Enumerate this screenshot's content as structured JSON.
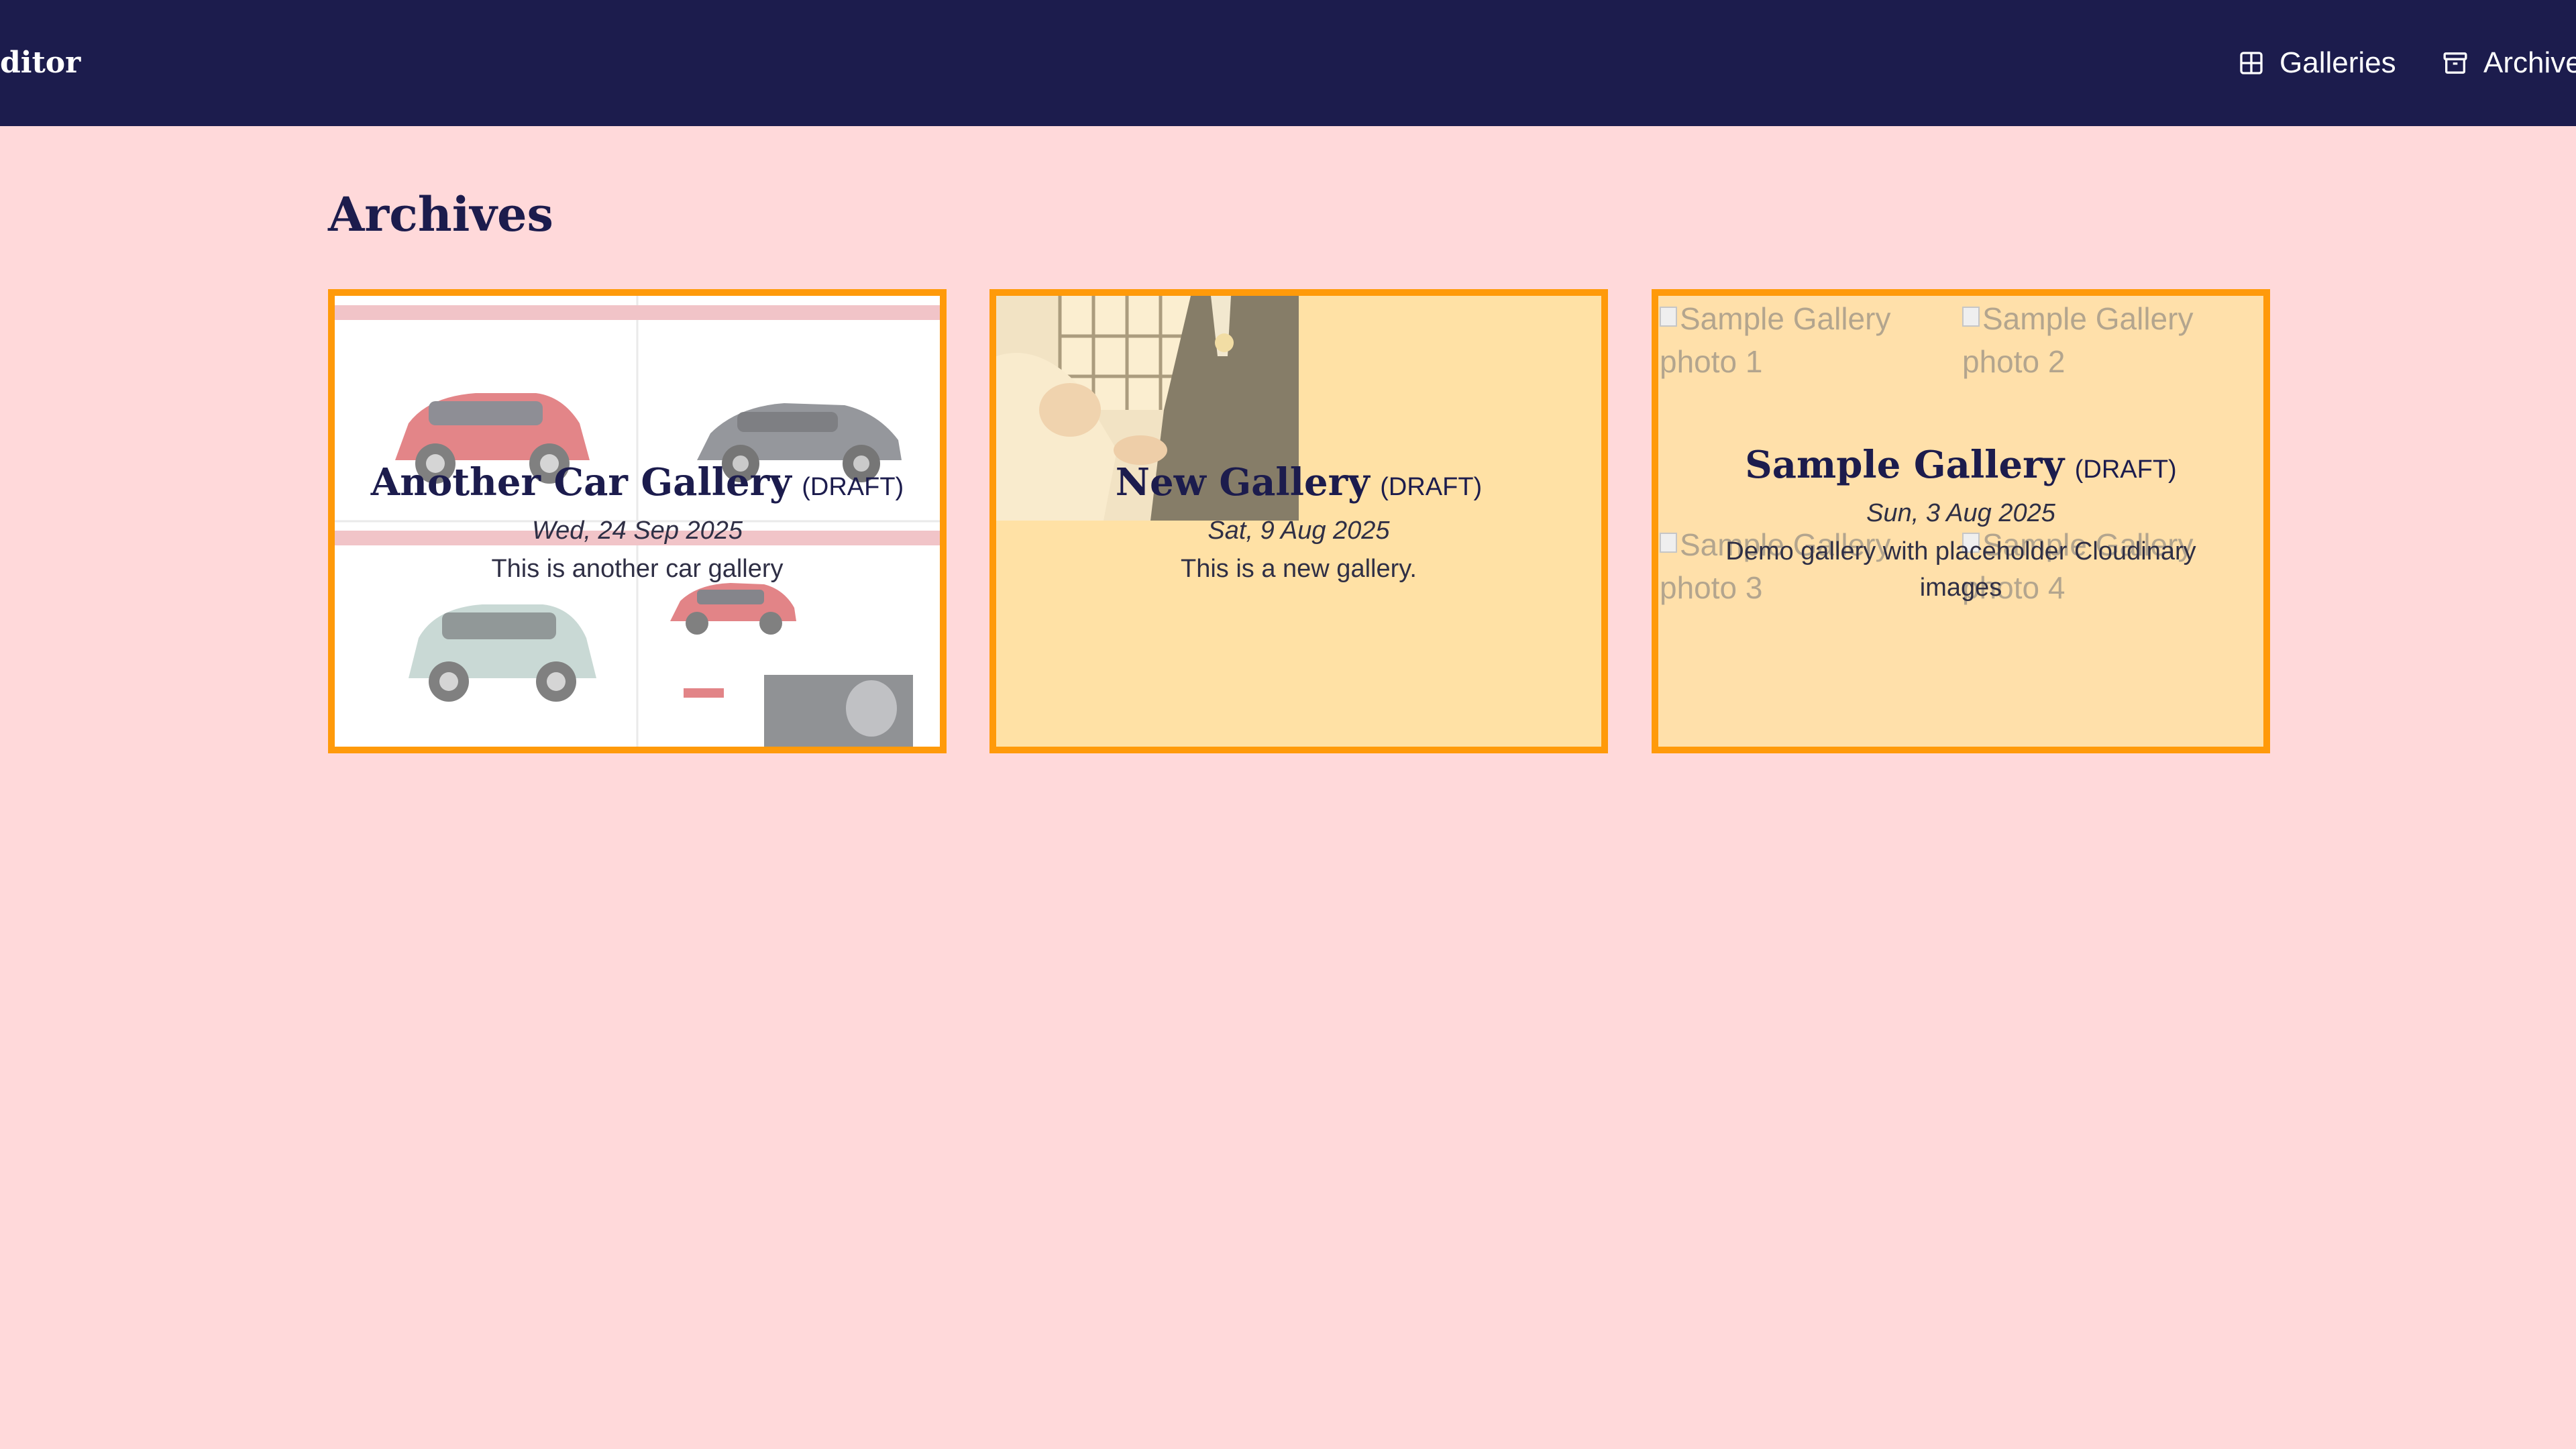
{
  "app": {
    "brand_partial": "ditor"
  },
  "nav": {
    "galleries_label": "Galleries",
    "archives_label": "Archives"
  },
  "page": {
    "title": "Archives"
  },
  "cards": [
    {
      "title": "Another Car Gallery",
      "status": "(DRAFT)",
      "date": "Wed, 24 Sep 2025",
      "description": "This is another car gallery"
    },
    {
      "title": "New Gallery",
      "status": "(DRAFT)",
      "date": "Sat, 9 Aug 2025",
      "description": "This is a new gallery."
    },
    {
      "title": "Sample Gallery",
      "status": "(DRAFT)",
      "date": "Sun, 3 Aug 2025",
      "description": "Demo gallery with placeholder Cloudinary images",
      "broken_images": [
        "Sample Gallery photo 1",
        "Sample Gallery photo 2",
        "Sample Gallery photo 3",
        "Sample Gallery photo 4"
      ]
    }
  ],
  "colors": {
    "header_bg": "#1c1c4d",
    "page_bg": "#ffd9da",
    "card_border": "#ff9a0a",
    "card_bg": "#ffe0aa",
    "title_text": "#1c1c4d"
  },
  "icons": {
    "galleries": "grid-icon",
    "archives": "archive-box-icon"
  }
}
